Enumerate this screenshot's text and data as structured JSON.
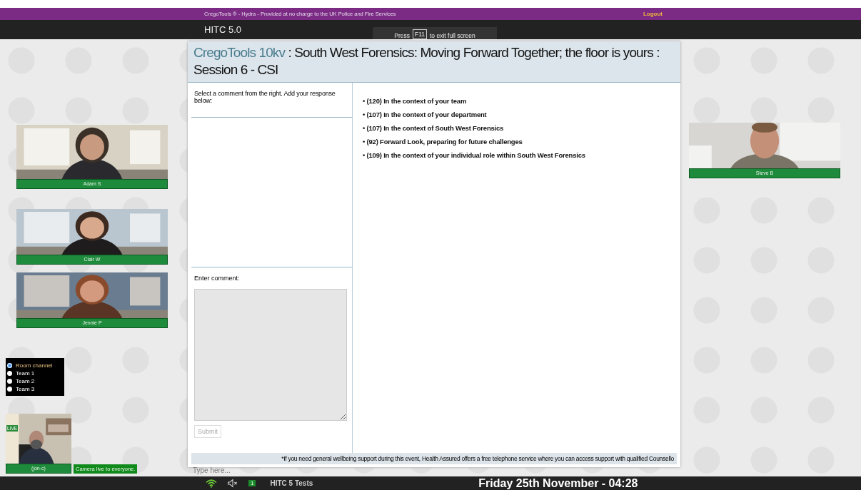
{
  "top_bar": {
    "notice": "CregoTools ® - Hydra - Provided at no charge to the UK Police and Fire Services",
    "logout": "Logout"
  },
  "app_bar": {
    "title": "HITC 5.0",
    "hint_before": "Press",
    "hint_key": "F11",
    "hint_after": "to exit full screen"
  },
  "participants_left": [
    {
      "name": "Adam S",
      "kind": "picture"
    },
    {
      "name": "Clair W",
      "kind": "picture"
    },
    {
      "name": "Jennie P",
      "kind": "picture"
    }
  ],
  "participants_right": [
    {
      "name": "Steve B",
      "kind": "picture"
    }
  ],
  "channels": [
    {
      "label": "Room channel",
      "selected": true
    },
    {
      "label": "Team 1",
      "selected": false
    },
    {
      "label": "Team 2",
      "selected": false
    },
    {
      "label": "Team 3",
      "selected": false
    }
  ],
  "self_view": {
    "badge": "LIVE",
    "name": "(jon-c)",
    "status": "Camera live to everyone."
  },
  "dialog": {
    "title_brand": "CregoTools 10kv",
    "title_rest": " : South West Forensics: Moving Forward Together; the floor is yours : Session 6 - CSI",
    "instructions": "Select a comment from the right. Add your response below:",
    "comment_label": "Enter comment:",
    "submit": {
      "label": "Submit",
      "disabled": true
    },
    "comments": [
      "• (120) In the context of your team",
      "• (107) In the context of your department",
      "• (107) In the context of South West Forensics",
      "• (92) Forward Look, preparing for future challenges",
      "• (109) In the context of your individual role within South West Forensics"
    ],
    "footer": "*If you need general wellbeing support during this event, Health Assured offers a free telephone service where you can access support with qualified Counsello"
  },
  "chat_input": {
    "placeholder": "Type here..."
  },
  "taskbar": {
    "badge": "1",
    "label": "HITC 5 Tests",
    "clock": "Friday 25th November - 04:28"
  }
}
